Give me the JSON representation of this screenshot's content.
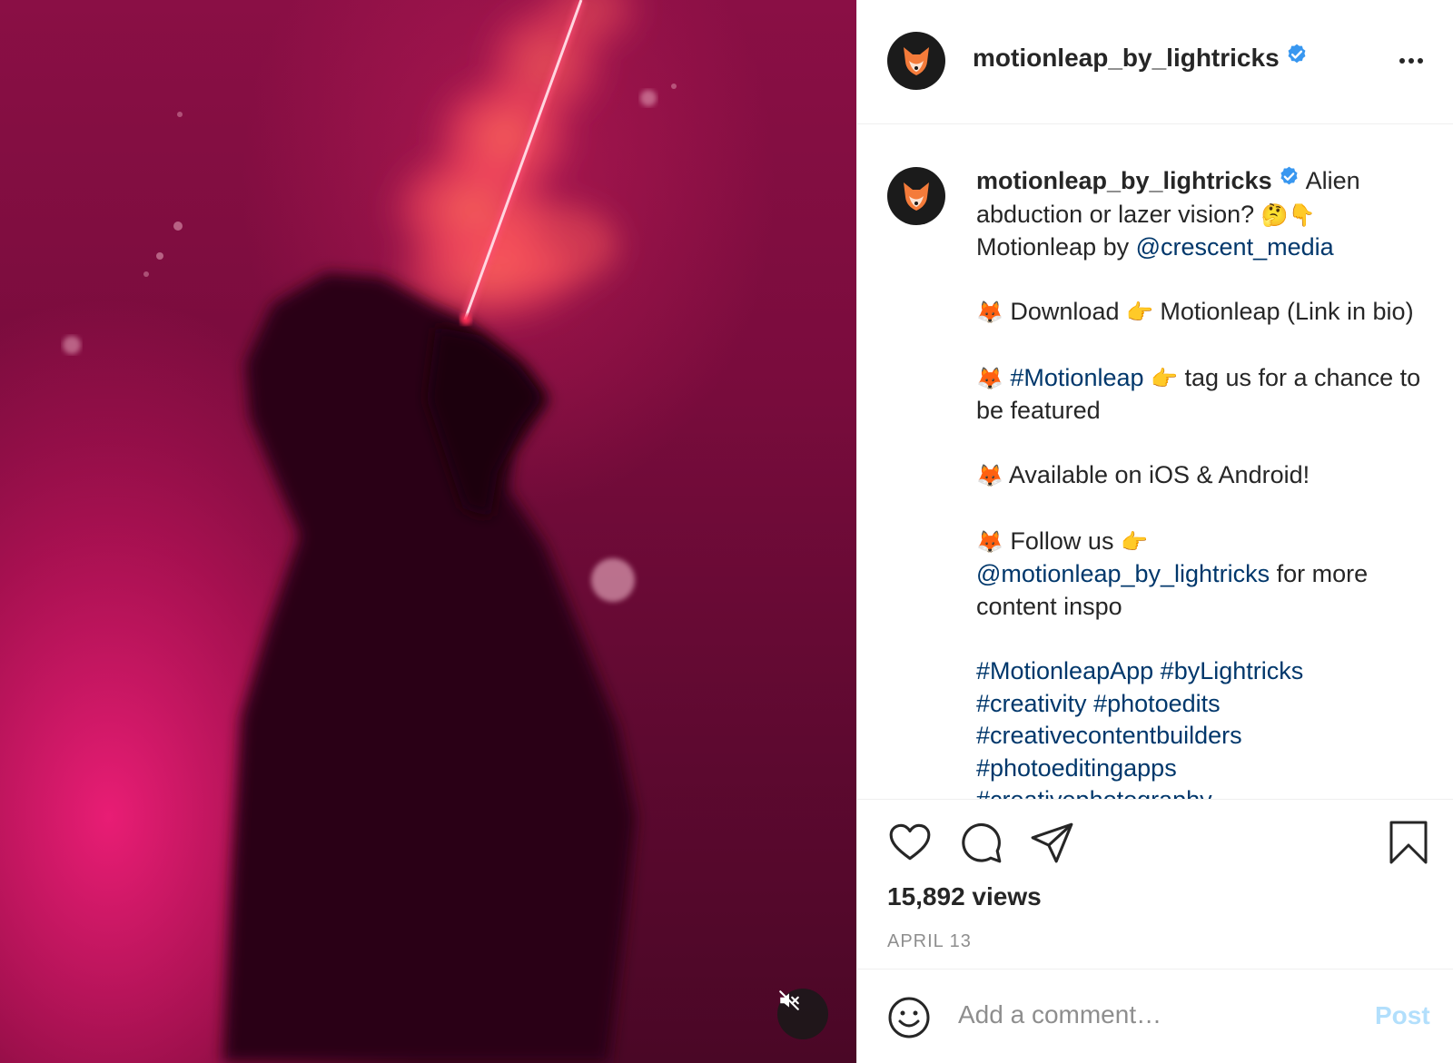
{
  "post": {
    "username": "motionleap_by_lightricks",
    "verified": true,
    "caption": {
      "line1": "Alien abduction or lazer vision?",
      "line1_emoji": "🤔👇",
      "credit_prefix": "Motionleap by",
      "credit_link": "@crescent_media",
      "download": {
        "emoji": "🦊",
        "text": "Download",
        "pointer": "👉",
        "text2": "Motionleap (Link in bio)"
      },
      "tag": {
        "emoji": "🦊",
        "hashtag": "#Motionleap",
        "pointer": "👉",
        "text": "tag us for a chance to be featured"
      },
      "available": {
        "emoji": "🦊",
        "text": "Available on iOS & Android!"
      },
      "follow": {
        "emoji": "🦊",
        "text": "Follow us",
        "pointer": "👉",
        "link": "@motionleap_by_lightricks",
        "suffix": "for more content inspo"
      },
      "hashtags": [
        "#MotionleapApp",
        "#byLightricks",
        "#creativity",
        "#photoedits",
        "#creativecontentbuilders",
        "#photoeditingapps",
        "#creativephotography"
      ]
    },
    "views": "15,892 views",
    "date": "APRIL 13"
  },
  "comment_box": {
    "placeholder": "Add a comment…",
    "post_label": "Post"
  },
  "icons": {
    "more": "more-options-icon",
    "like": "heart-icon",
    "comment": "comment-bubble-icon",
    "share": "paper-plane-icon",
    "save": "bookmark-icon",
    "emoji": "smiley-icon",
    "mute": "speaker-muted-icon",
    "verified": "verified-badge-icon"
  },
  "colors": {
    "link": "#00376b",
    "verified": "#3897f0",
    "post_disabled": "#b2dffc",
    "muted_text": "#8e8e8e",
    "media_pink": "#e0106a"
  }
}
